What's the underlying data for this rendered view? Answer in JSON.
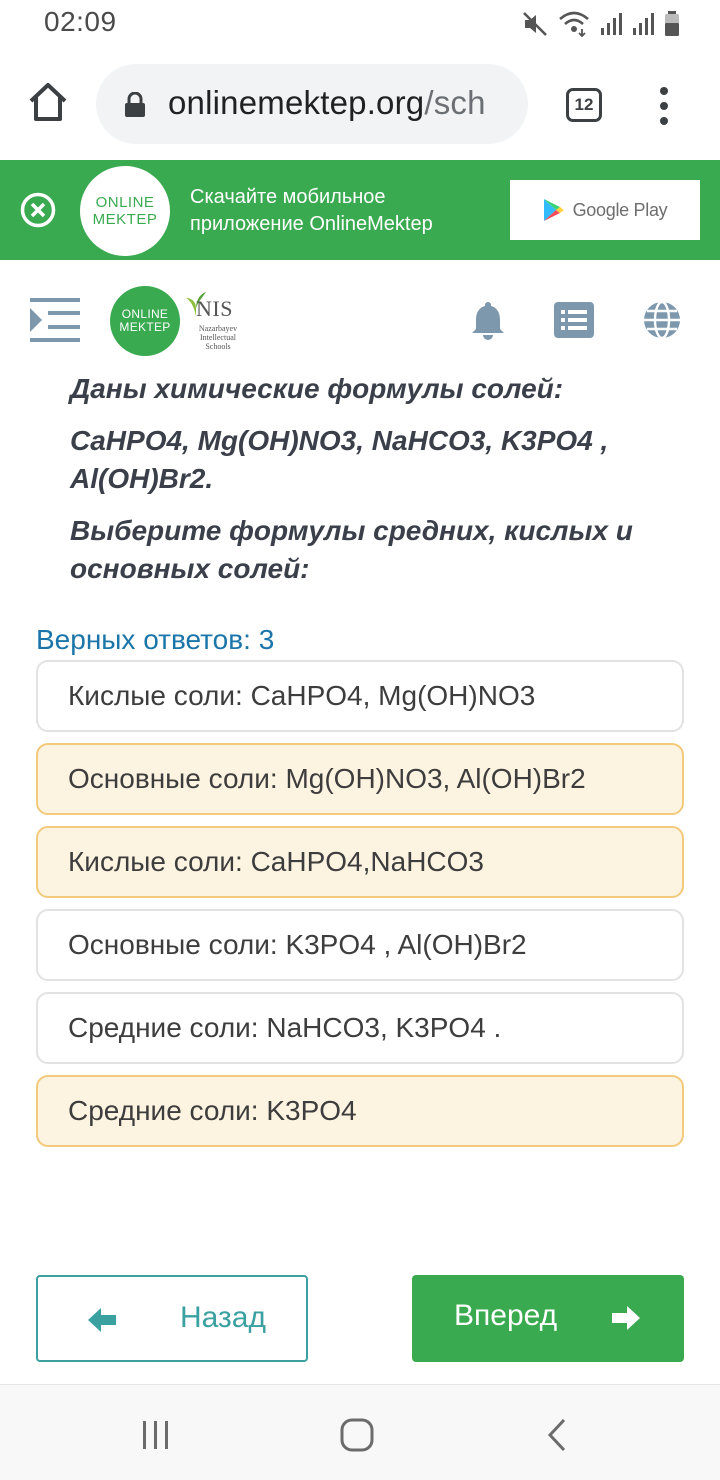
{
  "status_bar": {
    "time": "02:09"
  },
  "browser": {
    "url_domain": "onlinemektep.org",
    "url_path": "/sch",
    "tab_count": "12"
  },
  "banner": {
    "logo_line1": "ONLINE",
    "logo_line2": "MEKTEP",
    "text_line1": "Скачайте мобильное",
    "text_line2": "приложение OnlineMektep",
    "store_label": "Google Play"
  },
  "header": {
    "logo_line1": "ONLINE",
    "logo_line2": "MEKTEP",
    "nis_title": "NIS",
    "nis_subtitle": "Nazarbayev Intellectual Schools"
  },
  "question": {
    "line1": "Даны химические формулы солей:",
    "line2": "CaHPO4, Mg(OH)NO3, NaHCO3, K3PO4 , Al(OH)Br2.",
    "line3": "Выберите формулы средних, кислых и основных солей:"
  },
  "answers": {
    "correct_count_label": "Верных ответов: 3",
    "options": [
      {
        "text": "Кислые соли: CaHPO4, Mg(OH)NO3",
        "selected": false
      },
      {
        "text": "Основные соли: Mg(OH)NO3, Al(OH)Br2",
        "selected": true
      },
      {
        "text": "Кислые соли: CaHPO4,NaHCO3",
        "selected": true
      },
      {
        "text": "Основные соли: K3PO4 , Al(OH)Br2",
        "selected": false
      },
      {
        "text": "Средние соли: NaHCO3, K3PO4 .",
        "selected": false
      },
      {
        "text": "Средние соли: K3PO4",
        "selected": true
      }
    ]
  },
  "navigation": {
    "back_label": "Назад",
    "next_label": "Вперед"
  },
  "icons": {
    "status": [
      "mute-icon",
      "wifi-icon",
      "signal-icon",
      "signal-icon",
      "battery-icon"
    ],
    "browser": [
      "home-icon",
      "lock-icon",
      "tabs-icon",
      "more-vert-icon"
    ],
    "header": [
      "menu-toggle-icon",
      "bell-icon",
      "list-icon",
      "globe-icon"
    ],
    "system": [
      "recent-apps-icon",
      "home-circle-icon",
      "back-icon"
    ]
  },
  "colors": {
    "brand_green": "#3aaa51",
    "selected_bg": "#fdf3e1",
    "selected_border": "#f3c97b",
    "link_blue": "#1b75a9",
    "teal": "#3aa0a0"
  }
}
